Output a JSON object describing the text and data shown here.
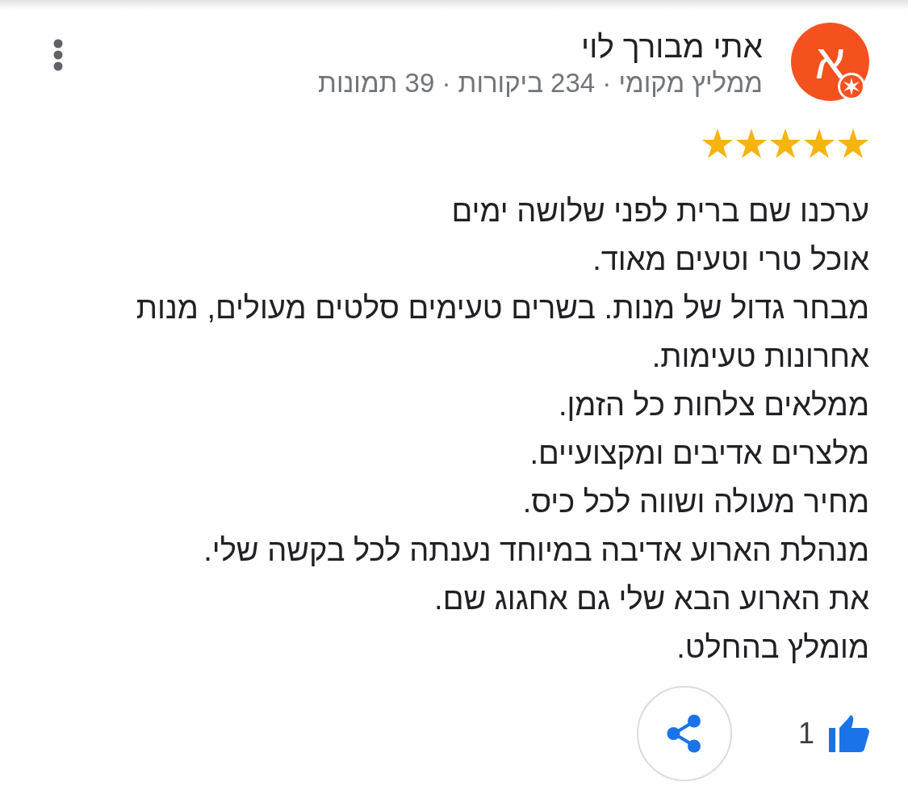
{
  "reviewer": {
    "avatar_letter": "א",
    "local_guide": true,
    "name": "אתי מבורך לוי",
    "meta": "ממליץ מקומי · 234 ביקורות · 39 תמונות"
  },
  "rating": {
    "stars": 5
  },
  "review": {
    "text": "ערכנו שם ברית לפני שלושה ימים\nאוכל טרי וטעים מאוד.\nמבחר גדול של מנות. בשרים טעימים סלטים מעולים, מנות אחרונות טעימות.\nממלאים צלחות כל הזמן.\nמלצרים אדיבים ומקצועיים.\nמחיר מעולה ושווה לכל כיס.\nמנהלת הארוע אדיבה במיוחד נענתה לכל בקשה שלי.\nאת הארוע הבא שלי גם אחגוג שם.\nמומלץ בהחלט."
  },
  "actions": {
    "like_count": "1",
    "liked": true
  }
}
